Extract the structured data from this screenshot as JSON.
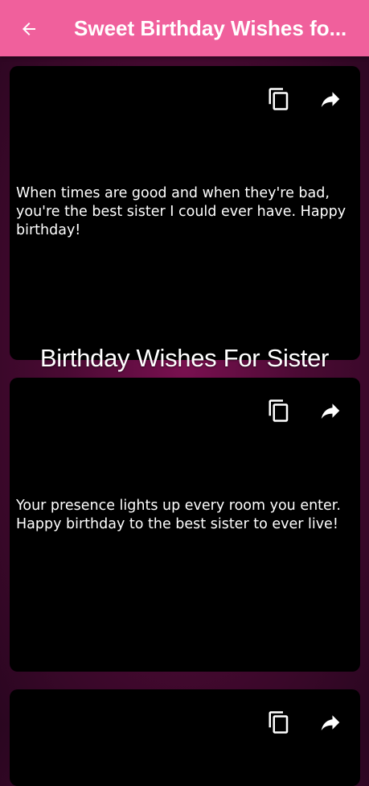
{
  "appbar": {
    "title": "Sweet Birthday Wishes fo...",
    "back_icon": "arrow-left-icon",
    "color": "#f0609c"
  },
  "section": {
    "title": "Birthday Wishes For Sister"
  },
  "cards": [
    {
      "text": "When times are good and when they're bad, you're the best sister I could ever have. Happy birthday!"
    },
    {
      "text": "Your presence lights up every room you enter. Happy birthday to the best sister to ever live!"
    },
    {
      "text": ""
    }
  ],
  "card_actions": {
    "copy_icon": "copy-icon",
    "share_icon": "share-icon"
  }
}
